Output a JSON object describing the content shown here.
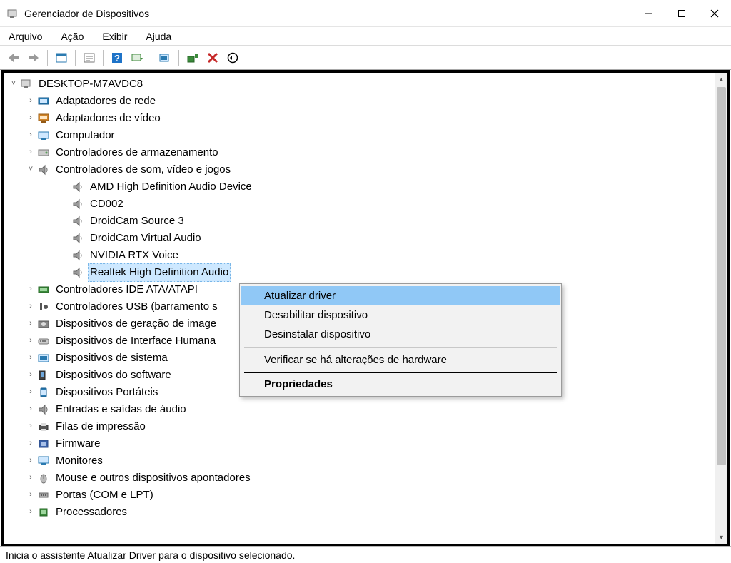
{
  "window": {
    "title": "Gerenciador de Dispositivos"
  },
  "menu": {
    "items": [
      "Arquivo",
      "Ação",
      "Exibir",
      "Ajuda"
    ]
  },
  "toolbar": {
    "icons": [
      "back-icon",
      "forward-icon",
      "show-hidden-icon",
      "properties-icon",
      "help-icon",
      "scan-hardware-icon",
      "update-driver-icon",
      "add-legacy-icon",
      "uninstall-icon",
      "enable-icon"
    ]
  },
  "tree": {
    "root": "DESKTOP-M7AVDC8",
    "categories": [
      {
        "label": "Adaptadores de rede",
        "icon": "network",
        "expanded": false
      },
      {
        "label": "Adaptadores de vídeo",
        "icon": "display",
        "expanded": false
      },
      {
        "label": "Computador",
        "icon": "computer",
        "expanded": false
      },
      {
        "label": "Controladores de armazenamento",
        "icon": "storage",
        "expanded": false
      },
      {
        "label": "Controladores de som, vídeo e jogos",
        "icon": "sound",
        "expanded": true,
        "children": [
          "AMD High Definition Audio Device",
          "CD002",
          "DroidCam Source 3",
          "DroidCam Virtual Audio",
          "NVIDIA RTX Voice",
          "Realtek High Definition Audio"
        ],
        "selected_child_index": 5
      },
      {
        "label": "Controladores IDE ATA/ATAPI",
        "icon": "ide",
        "expanded": false
      },
      {
        "label": "Controladores USB (barramento s",
        "icon": "usb",
        "expanded": false,
        "truncated": true
      },
      {
        "label": "Dispositivos de geração de image",
        "icon": "imaging",
        "expanded": false,
        "truncated": true
      },
      {
        "label": "Dispositivos de Interface Humana",
        "icon": "hid",
        "expanded": false,
        "truncated": true
      },
      {
        "label": "Dispositivos de sistema",
        "icon": "system",
        "expanded": false
      },
      {
        "label": "Dispositivos do software",
        "icon": "software",
        "expanded": false
      },
      {
        "label": "Dispositivos Portáteis",
        "icon": "portable",
        "expanded": false
      },
      {
        "label": "Entradas e saídas de áudio",
        "icon": "sound",
        "expanded": false
      },
      {
        "label": "Filas de impressão",
        "icon": "printer",
        "expanded": false
      },
      {
        "label": "Firmware",
        "icon": "firmware",
        "expanded": false
      },
      {
        "label": "Monitores",
        "icon": "monitor",
        "expanded": false
      },
      {
        "label": "Mouse e outros dispositivos apontadores",
        "icon": "mouse",
        "expanded": false
      },
      {
        "label": "Portas (COM e LPT)",
        "icon": "ports",
        "expanded": false
      },
      {
        "label": "Processadores",
        "icon": "cpu",
        "expanded": false
      }
    ]
  },
  "context_menu": {
    "items": [
      {
        "label": "Atualizar driver",
        "highlight": true
      },
      {
        "label": "Desabilitar dispositivo"
      },
      {
        "label": "Desinstalar dispositivo"
      },
      {
        "separator": true
      },
      {
        "label": "Verificar se há alterações de hardware"
      },
      {
        "heavy_separator": true
      },
      {
        "label": "Propriedades",
        "bold": true
      }
    ]
  },
  "statusbar": {
    "text": "Inicia o assistente Atualizar Driver para o dispositivo selecionado."
  }
}
